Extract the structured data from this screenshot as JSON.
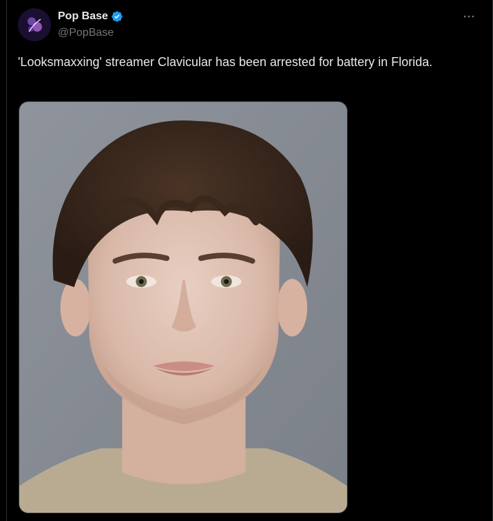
{
  "tweet": {
    "author": {
      "display_name": "Pop Base",
      "handle": "@PopBase",
      "verified": true,
      "avatar_icon": "pop-base-logo-icon"
    },
    "text": "'Looksmaxxing' streamer Clavicular has been arrested for battery in Florida.",
    "more_icon": "more-options-icon",
    "media": {
      "type": "photo",
      "subject": "mugshot"
    }
  },
  "colors": {
    "background": "#000000",
    "text_primary": "#e7e9ea",
    "text_secondary": "#71767b",
    "verified_badge": "#1d9bf0",
    "border": "#2f3336"
  }
}
